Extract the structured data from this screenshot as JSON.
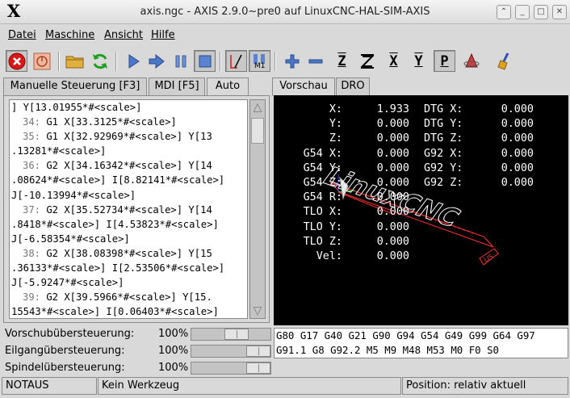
{
  "window": {
    "title": "axis.ngc - AXIS 2.9.0~pre0 auf LinuxCNC-HAL-SIM-AXIS",
    "logo": "X"
  },
  "menu": [
    {
      "label": "Datei"
    },
    {
      "label": "Maschine"
    },
    {
      "label": "Ansicht"
    },
    {
      "label": "Hilfe"
    }
  ],
  "toolbar": {
    "axis_x": "X",
    "axis_y": "Y",
    "axis_z": "Z",
    "perspective": "P",
    "m1_label": "M1"
  },
  "left_tabs": [
    {
      "label": "Manuelle Steuerung [F3]"
    },
    {
      "label": "MDI [F5]"
    },
    {
      "label": "Auto"
    }
  ],
  "right_tabs": [
    {
      "label": "Vorschau"
    },
    {
      "label": "DRO"
    }
  ],
  "program_lines": [
    {
      "num": "",
      "text": "] Y[13.01955*#<scale>]"
    },
    {
      "num": "34:",
      "text": " G1 X[33.3125*#<scale>]"
    },
    {
      "num": "35:",
      "text": " G1 X[32.92969*#<scale>] Y[13"
    },
    {
      "num": "",
      "text": ".13281*#<scale>]"
    },
    {
      "num": "36:",
      "text": " G2 X[34.16342*#<scale>] Y[14"
    },
    {
      "num": "",
      "text": ".08624*#<scale>] I[8.82141*#<scale>]"
    },
    {
      "num": "",
      "text": "J[-10.13994*#<scale>]"
    },
    {
      "num": "37:",
      "text": " G2 X[35.52734*#<scale>] Y[14"
    },
    {
      "num": "",
      "text": ".8418*#<scale>] I[4.53823*#<scale>]"
    },
    {
      "num": "",
      "text": "J[-6.58354*#<scale>]"
    },
    {
      "num": "38:",
      "text": " G2 X[38.08398*#<scale>] Y[15"
    },
    {
      "num": "",
      "text": ".36133*#<scale>] I[2.53506*#<scale>]"
    },
    {
      "num": "",
      "text": "J[-5.9247*#<scale>]"
    },
    {
      "num": "39:",
      "text": " G2 X[39.5966*#<scale>] Y[15."
    },
    {
      "num": "",
      "text": "15543*#<scale>] I[0.06403*#<scale>]"
    },
    {
      "num": "",
      "text": "J[-4.74845*#<scale>]"
    }
  ],
  "dro": [
    {
      "label": "X:",
      "value": "1.933",
      "dtg_label": "DTG X:",
      "dtg_value": "0.000"
    },
    {
      "label": "Y:",
      "value": "0.000",
      "dtg_label": "DTG Y:",
      "dtg_value": "0.000"
    },
    {
      "label": "Z:",
      "value": "0.000",
      "dtg_label": "DTG Z:",
      "dtg_value": "0.000"
    },
    {
      "label": "G54 X:",
      "value": "0.000",
      "dtg_label": "G92 X:",
      "dtg_value": "0.000"
    },
    {
      "label": "G54 Y:",
      "value": "0.000",
      "dtg_label": "G92 Y:",
      "dtg_value": "0.000"
    },
    {
      "label": "G54 Z:",
      "value": "0.000",
      "dtg_label": "G92 Z:",
      "dtg_value": "0.000"
    },
    {
      "label": "G54 R:",
      "value": "0.000",
      "dtg_label": "",
      "dtg_value": ""
    },
    {
      "label": "TLO X:",
      "value": "0.000",
      "dtg_label": "",
      "dtg_value": ""
    },
    {
      "label": "TLO Y:",
      "value": "0.000",
      "dtg_label": "",
      "dtg_value": ""
    },
    {
      "label": "TLO Z:",
      "value": "0.000",
      "dtg_label": "",
      "dtg_value": ""
    },
    {
      "label": "Vel:",
      "value": "0.000",
      "dtg_label": "",
      "dtg_value": ""
    }
  ],
  "preview_text": "LinuxCNC",
  "gcodes": {
    "line1": "G80 G17 G40 G21 G90 G94 G54 G49 G99 G64 G97",
    "line2": "G91.1 G8 G92.2 M5 M9 M48 M53 M0 F0 S0"
  },
  "overrides": [
    {
      "label": "Vorschubübersteuerung:",
      "value": "100",
      "unit": "%",
      "level": 0.6
    },
    {
      "label": "Eilgangübersteuerung:",
      "value": "100",
      "unit": "%",
      "level": 1.0
    },
    {
      "label": "Spindelübersteuerung:",
      "value": "100",
      "unit": "%",
      "level": 1.0
    }
  ],
  "status": {
    "estop": "NOTAUS",
    "tool": "Kein Werkzeug",
    "position": "Position: relativ aktuell"
  },
  "colors": {
    "preview_bg": "#000000",
    "path_red": "#ff3030",
    "dro_text": "#ffffff"
  }
}
